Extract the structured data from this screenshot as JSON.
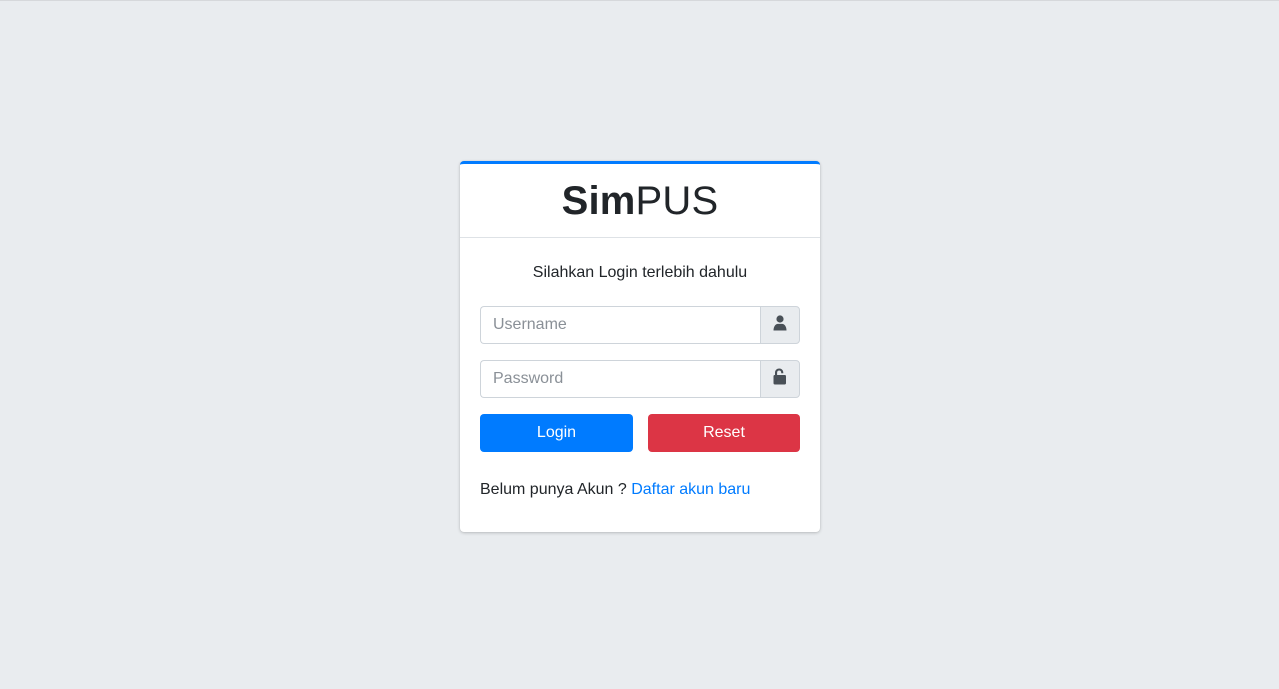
{
  "brand": {
    "bold": "Sim",
    "regular": "PUS"
  },
  "login_message": "Silahkan Login terlebih dahulu",
  "form": {
    "username_placeholder": "Username",
    "password_placeholder": "Password",
    "username_icon": "user-icon",
    "password_icon": "unlock-icon"
  },
  "buttons": {
    "login_label": "Login",
    "reset_label": "Reset"
  },
  "register": {
    "prompt": "Belum punya Akun ? ",
    "link_label": "Daftar akun baru"
  },
  "colors": {
    "background": "#e9ecef",
    "primary": "#007bff",
    "danger": "#dc3545"
  }
}
